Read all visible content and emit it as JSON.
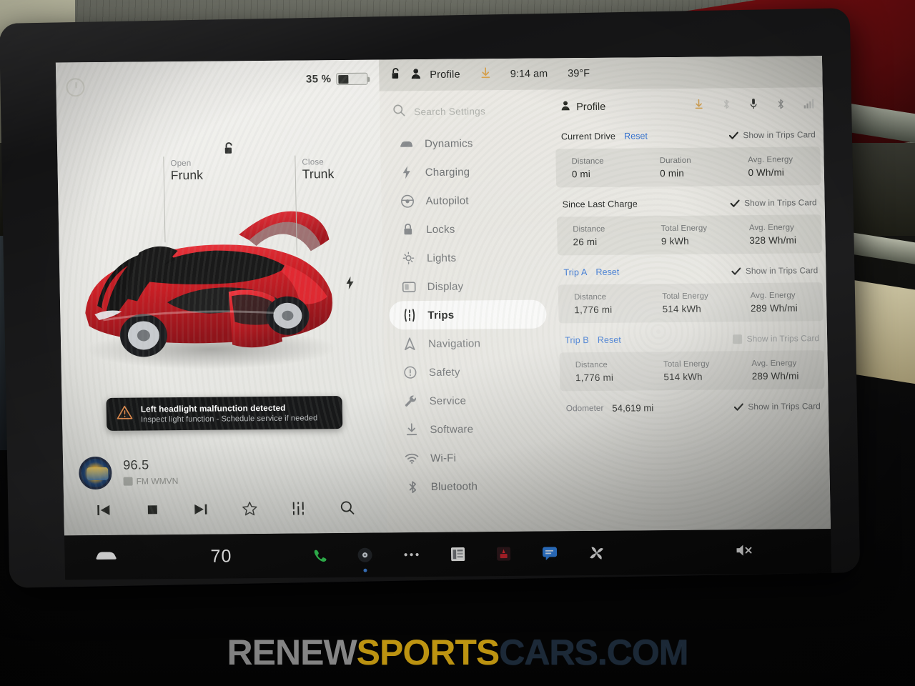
{
  "device": {
    "name": "Tesla Model 3 center touchscreen"
  },
  "left_panel": {
    "battery": {
      "percent_label": "35 %",
      "percent_value": 35
    },
    "timer_icon": "timer-icon",
    "frunk": {
      "action": "Open",
      "name": "Frunk"
    },
    "trunk": {
      "action": "Close",
      "name": "Trunk"
    },
    "lock_state_icon": "unlocked-padlock-icon",
    "charge_port_icon": "lightning-bolt-icon",
    "alert": {
      "icon": "warning-triangle-icon",
      "title": "Left headlight malfunction detected",
      "subtitle": "Inspect light function - Schedule service if needed"
    },
    "media": {
      "frequency": "96.5",
      "station": "FM WMVN",
      "controls": [
        {
          "name": "previous-track-button",
          "glyph": "prev"
        },
        {
          "name": "stop-button",
          "glyph": "stop"
        },
        {
          "name": "next-track-button",
          "glyph": "next"
        },
        {
          "name": "favorite-button",
          "glyph": "star"
        },
        {
          "name": "equalizer-button",
          "glyph": "sliders"
        },
        {
          "name": "media-search-button",
          "glyph": "search"
        }
      ]
    }
  },
  "status_bar": {
    "lock_icon": "unlocked-padlock-icon",
    "profile_icon": "person-icon",
    "profile_label": "Profile",
    "download_icon": "download-arrow-icon",
    "time": "9:14 am",
    "temperature": "39°F"
  },
  "search": {
    "icon": "search-icon",
    "placeholder": "Search Settings",
    "value": ""
  },
  "sidebar": {
    "items": [
      {
        "label": "Dynamics",
        "icon": "car-dynamics-icon",
        "active": false
      },
      {
        "label": "Charging",
        "icon": "bolt-icon",
        "active": false
      },
      {
        "label": "Autopilot",
        "icon": "steering-wheel-icon",
        "active": false
      },
      {
        "label": "Locks",
        "icon": "padlock-icon",
        "active": false
      },
      {
        "label": "Lights",
        "icon": "sun-lights-icon",
        "active": false
      },
      {
        "label": "Display",
        "icon": "display-icon",
        "active": false
      },
      {
        "label": "Trips",
        "icon": "trips-road-icon",
        "active": true
      },
      {
        "label": "Navigation",
        "icon": "navigation-arrow-icon",
        "active": false
      },
      {
        "label": "Safety",
        "icon": "exclamation-circle-icon",
        "active": false
      },
      {
        "label": "Service",
        "icon": "wrench-icon",
        "active": false
      },
      {
        "label": "Software",
        "icon": "download-icon",
        "active": false
      },
      {
        "label": "Wi-Fi",
        "icon": "wifi-icon",
        "active": false
      },
      {
        "label": "Bluetooth",
        "icon": "bluetooth-icon",
        "active": false
      }
    ]
  },
  "content": {
    "profile_label": "Profile",
    "profile_icons": [
      "download-arrow-icon",
      "bluetooth-faded-icon",
      "microphone-icon",
      "bluetooth-icon",
      "signal-bars-icon"
    ],
    "reset_label": "Reset",
    "show_in_trips_label": "Show in Trips Card",
    "sections": [
      {
        "title": "Current Drive",
        "title_blue": false,
        "has_reset": true,
        "show_in_trips": true,
        "stats": [
          {
            "key": "Distance",
            "value": "0 mi"
          },
          {
            "key": "Duration",
            "value": "0 min"
          },
          {
            "key": "Avg. Energy",
            "value": "0 Wh/mi"
          }
        ]
      },
      {
        "title": "Since Last Charge",
        "title_blue": false,
        "has_reset": false,
        "show_in_trips": true,
        "stats": [
          {
            "key": "Distance",
            "value": "26 mi"
          },
          {
            "key": "Total Energy",
            "value": "9 kWh"
          },
          {
            "key": "Avg. Energy",
            "value": "328 Wh/mi"
          }
        ]
      },
      {
        "title": "Trip A",
        "title_blue": true,
        "has_reset": true,
        "show_in_trips": true,
        "stats": [
          {
            "key": "Distance",
            "value": "1,776 mi"
          },
          {
            "key": "Total Energy",
            "value": "514 kWh"
          },
          {
            "key": "Avg. Energy",
            "value": "289 Wh/mi"
          }
        ]
      },
      {
        "title": "Trip B",
        "title_blue": true,
        "has_reset": true,
        "show_in_trips": false,
        "stats": [
          {
            "key": "Distance",
            "value": "1,776 mi"
          },
          {
            "key": "Total Energy",
            "value": "514 kWh"
          },
          {
            "key": "Avg. Energy",
            "value": "289 Wh/mi"
          }
        ]
      }
    ],
    "odometer": {
      "label": "Odometer",
      "value": "54,619 mi",
      "show_in_trips": true
    }
  },
  "taskbar": {
    "car_icon": "car-icon",
    "temperature": "70",
    "apps": [
      {
        "name": "phone-icon"
      },
      {
        "name": "media-icon"
      },
      {
        "name": "apps-dots-icon"
      },
      {
        "name": "calendar-icon"
      },
      {
        "name": "theater-icon"
      },
      {
        "name": "messages-icon"
      },
      {
        "name": "fan-icon"
      }
    ],
    "mute_icon": "mute-icon"
  },
  "watermark": {
    "part1": "RENEW",
    "part2": "SPORTS",
    "part3": "CARS.COM"
  },
  "colors": {
    "accent_blue": "#2f6fd0",
    "alert_bg": "#0e0f10",
    "alert_icon": "#e08848",
    "car_red": "#cc1b22",
    "screen_bg": "#eceae5"
  }
}
